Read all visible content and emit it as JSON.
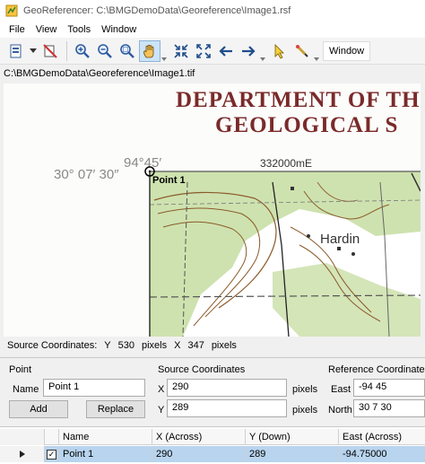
{
  "window": {
    "title": "GeoReferencer: C:\\BMGDemoData\\Georeference\\Image1.rsf"
  },
  "menu": [
    "File",
    "View",
    "Tools",
    "Window"
  ],
  "toolbar": {
    "window_label": "Window",
    "icons": [
      "new-layer-icon",
      "dropdown-arrow-icon",
      "delete-point-icon",
      "zoom-in-icon",
      "zoom-out-icon",
      "zoom-box-icon",
      "pan-hand-icon",
      "zoom-extents-icon",
      "fit-window-icon",
      "previous-view-icon",
      "next-view-icon",
      "select-arrow-icon",
      "add-point-icon"
    ]
  },
  "image_path": "C:\\BMGDemoData\\Georeference\\Image1.tif",
  "map": {
    "header_line1": "DEPARTMENT OF TH",
    "header_line2": "GEOLOGICAL S",
    "lon_label": "94°45′",
    "lat_label": "30° 07′ 30″",
    "easting_label": "332000mE",
    "town_label": "Hardin",
    "point_label": "Point 1"
  },
  "status": {
    "label": "Source Coordinates:",
    "y_label": "Y",
    "y_value": "530",
    "y_unit": "pixels",
    "x_label": "X",
    "x_value": "347",
    "x_unit": "pixels"
  },
  "point_panel": {
    "title": "Point",
    "name_label": "Name",
    "name_value": "Point 1",
    "add_label": "Add",
    "replace_label": "Replace"
  },
  "source_panel": {
    "title": "Source Coordinates",
    "x_label": "X",
    "x_value": "290",
    "x_unit": "pixels",
    "y_label": "Y",
    "y_value": "289",
    "y_unit": "pixels"
  },
  "reference_panel": {
    "title": "Reference Coordinates",
    "east_label": "East",
    "east_value": "-94 45",
    "north_label": "North",
    "north_value": "30 7 30"
  },
  "table": {
    "columns": [
      "Name",
      "X (Across)",
      "Y (Down)",
      "East (Across)"
    ],
    "rows": [
      {
        "checked": "✓",
        "name": "Point 1",
        "x": "290",
        "y": "289",
        "east": "-94.75000"
      }
    ]
  },
  "colors": {
    "active_tool": "#cce4f7",
    "selected_row": "#b8d4ee",
    "map_green": "#c9dfa6",
    "map_header_red": "#7a2a2a"
  }
}
